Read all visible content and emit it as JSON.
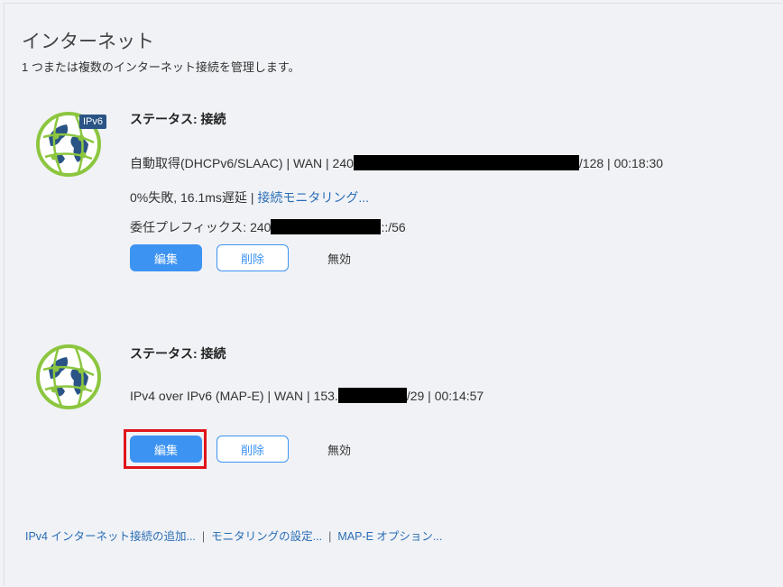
{
  "page": {
    "title": "インターネット",
    "subtitle": "1 つまたは複数のインターネット接続を管理します。"
  },
  "connections": [
    {
      "badge": "IPv6",
      "status": "ステータス: 接続",
      "detail_prefix": "自動取得(DHCPv6/SLAAC) | WAN | 240",
      "detail_suffix": "/128 | 00:18:30",
      "stats": "0%失敗, 16.1ms遅延 | ",
      "monitor_link": "接続モニタリング...",
      "prefix_label": "委任プレフィックス: 240",
      "prefix_suffix": "::/56",
      "edit_label": "編集",
      "delete_label": "削除",
      "disable_label": "無効"
    },
    {
      "status": "ステータス: 接続",
      "detail_prefix": "IPv4 over IPv6 (MAP-E) | WAN | 153.",
      "detail_suffix": "/29 | 00:14:57",
      "edit_label": "編集",
      "delete_label": "削除",
      "disable_label": "無効"
    }
  ],
  "footer": {
    "add_ipv4": "IPv4 インターネット接続の追加...",
    "monitoring_settings": "モニタリングの設定...",
    "mape_options": "MAP-E オプション...",
    "separator": "|"
  },
  "colors": {
    "accent": "#3d93f2",
    "link": "#2a6db5",
    "globe_green": "#8cc63f",
    "globe_blue": "#2a5485",
    "highlight_red": "#e0141b"
  }
}
